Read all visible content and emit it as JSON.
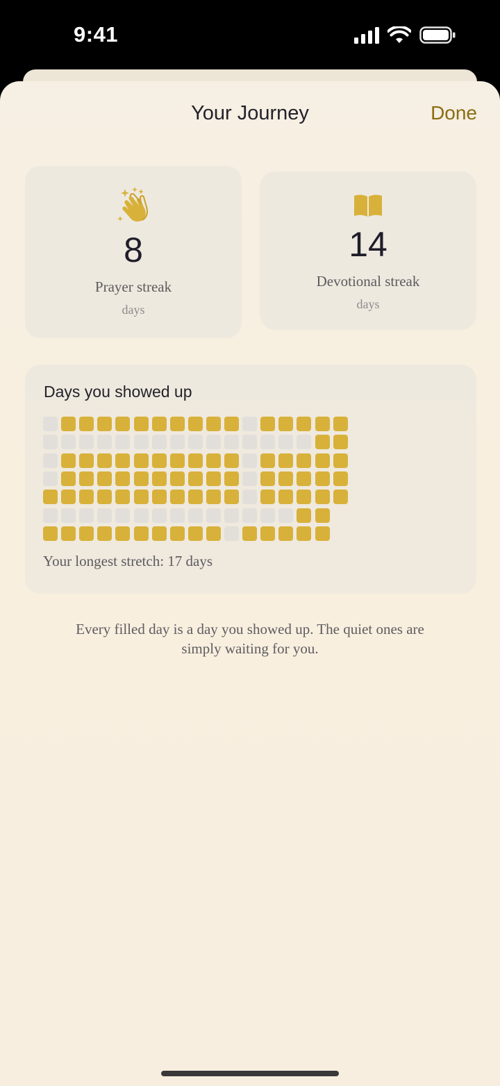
{
  "status_bar": {
    "time": "9:41"
  },
  "sheet": {
    "title": "Your Journey",
    "done_label": "Done"
  },
  "prayer_streak": {
    "icon": "clapping-hands-icon",
    "value": "8",
    "label": "Prayer streak",
    "unit": "days"
  },
  "devotional_streak": {
    "icon": "open-book-icon",
    "value": "14",
    "label": "Devotional streak",
    "unit": "days"
  },
  "days_grid": {
    "title": "Days you showed up",
    "rows": [
      "01111111111011111",
      "00000000000000011",
      "01111111111011111",
      "01111111111011111",
      "11111111111011111",
      "0000000000000011",
      "1111111111011111"
    ],
    "longest_stretch": "Your longest stretch: 17 days"
  },
  "footer": {
    "message": "Every filled day is a day you showed up. The quiet ones are simply waiting for you."
  },
  "colors": {
    "accent": "#d8b13a",
    "empty": "#e2dfda",
    "done": "#8a6d12"
  }
}
